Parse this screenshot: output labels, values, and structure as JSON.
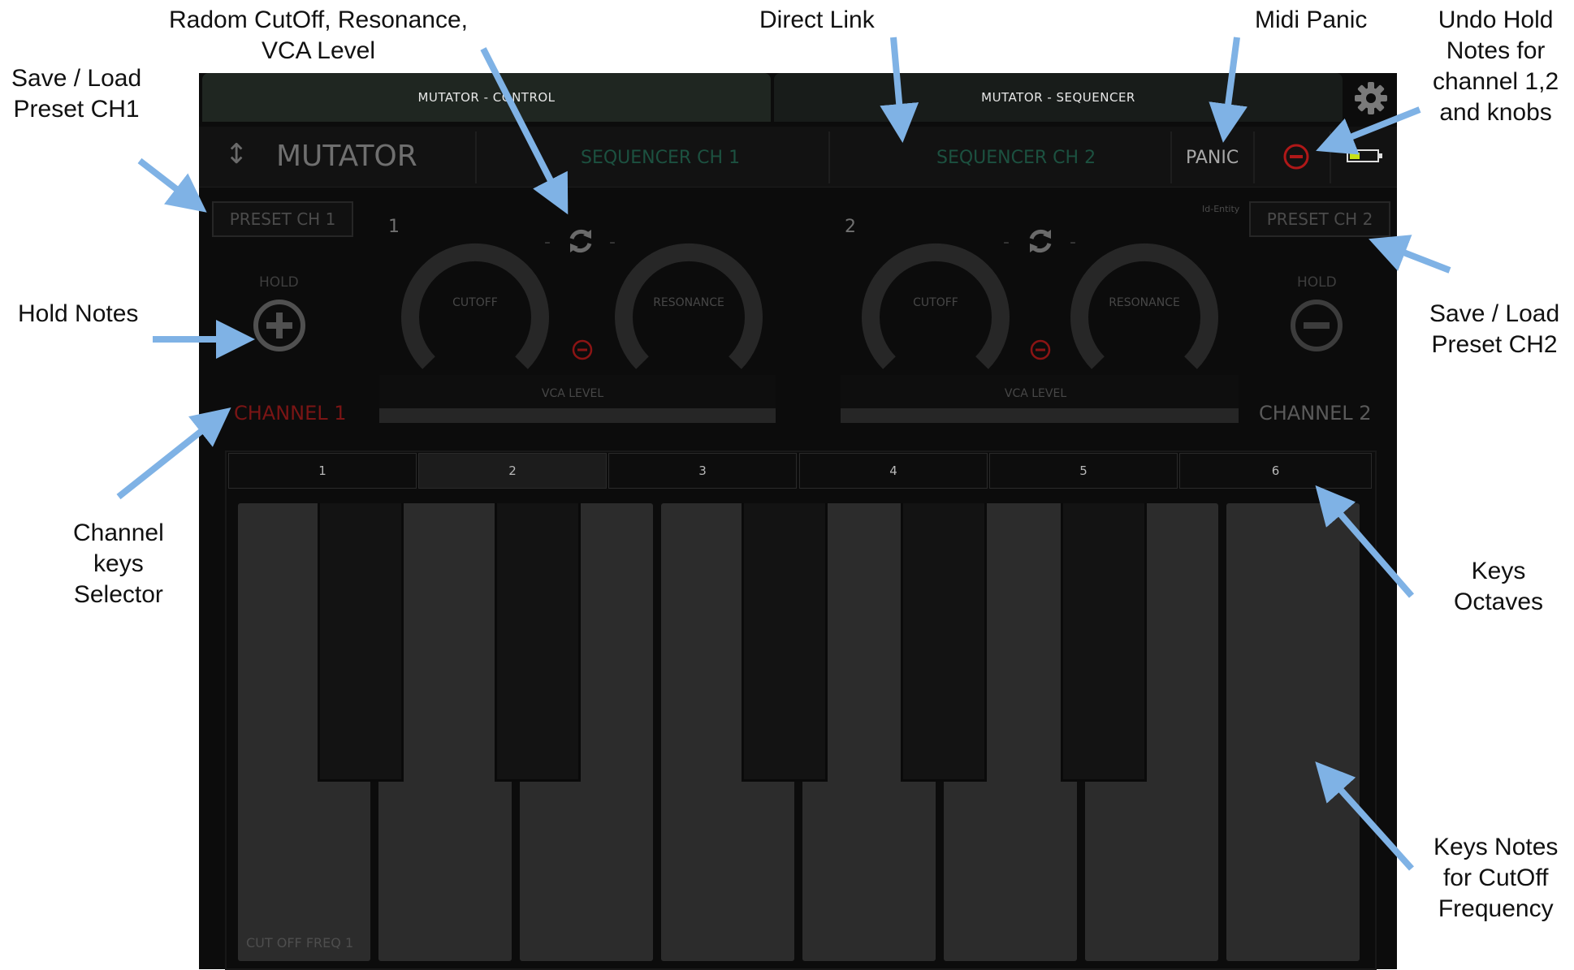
{
  "annotations": {
    "random": [
      "Radom CutOff, Resonance,",
      "VCA Level"
    ],
    "direct_link": [
      "Direct Link"
    ],
    "midi_panic": [
      "Midi Panic"
    ],
    "undo_hold": [
      "Undo Hold",
      "Notes for",
      "channel 1,2",
      "and knobs"
    ],
    "save_load_ch1": [
      "Save / Load",
      "Preset CH1"
    ],
    "hold_notes": [
      "Hold Notes"
    ],
    "save_load_ch2": [
      "Save / Load",
      "Preset CH2"
    ],
    "channel_selector": [
      "Channel",
      "keys",
      "Selector"
    ],
    "keys_octaves": [
      "Keys",
      "Octaves"
    ],
    "keys_notes": [
      "Keys Notes",
      "for CutOff",
      "Frequency"
    ]
  },
  "app": {
    "tabs": [
      "MUTATOR - CONTROL",
      "MUTATOR - SEQUENCER"
    ],
    "title": "MUTATOR",
    "sequencer_ch1": "SEQUENCER CH 1",
    "sequencer_ch2": "SEQUENCER CH 2",
    "panic": "PANIC",
    "id_entity": "Id-Entity",
    "ch1": {
      "preset": "PRESET CH 1",
      "hold": "HOLD",
      "number": "1",
      "cutoff": "CUTOFF",
      "resonance": "RESONANCE",
      "vca": "VCA LEVEL",
      "channel": "CHANNEL 1",
      "dash": "-"
    },
    "ch2": {
      "preset": "PRESET CH 2",
      "hold": "HOLD",
      "number": "2",
      "cutoff": "CUTOFF",
      "resonance": "RESONANCE",
      "vca": "VCA LEVEL",
      "channel": "CHANNEL 2",
      "dash": "-"
    },
    "octaves": [
      "1",
      "2",
      "3",
      "4",
      "5",
      "6"
    ],
    "selected_octave": "2",
    "cut_off_freq": "CUT OFF FREQ 1"
  },
  "colors": {
    "active_channel": "#7a1515",
    "inactive_channel": "#5a5a5a",
    "sequencer_text": "#1c5140",
    "undo_red": "#b01818",
    "arrow": "#7fb2e5",
    "battery": "#c8e016"
  },
  "icons": [
    "settings-gear-icon",
    "sort-arrows-icon",
    "undo-minus-icon",
    "battery-icon",
    "plus-hold-icon",
    "minus-hold-icon",
    "random-refresh-icon"
  ]
}
